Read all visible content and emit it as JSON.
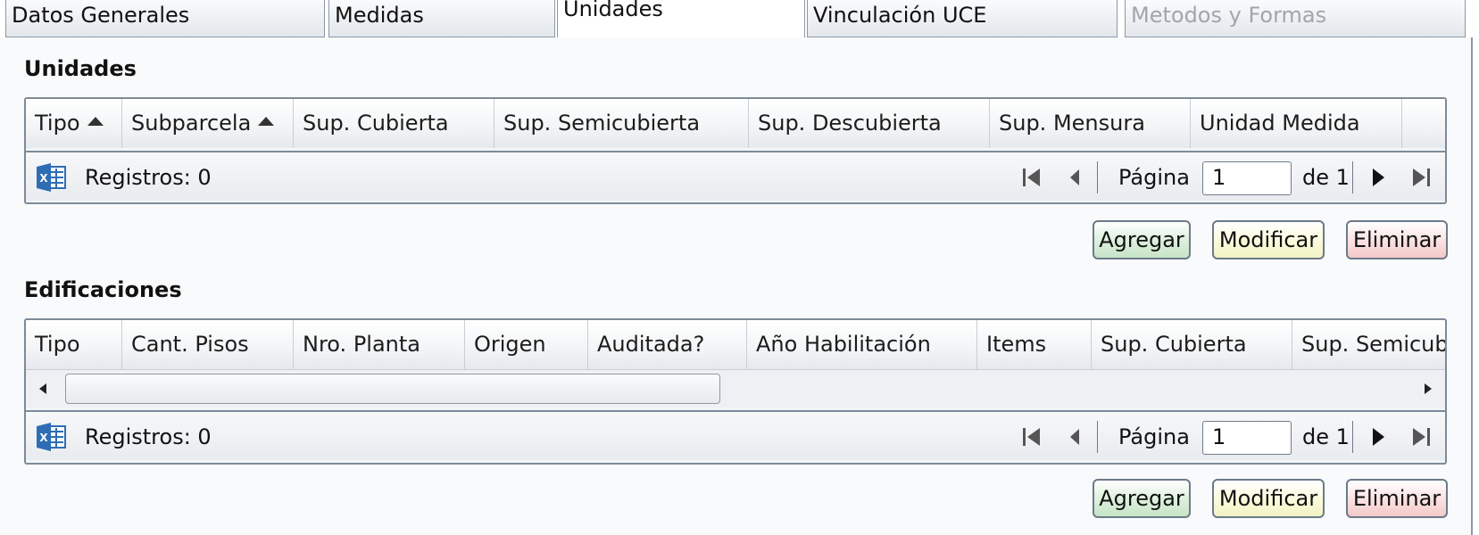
{
  "tabs": [
    {
      "label": "Datos Generales",
      "state": "normal"
    },
    {
      "label": "Medidas",
      "state": "normal"
    },
    {
      "label": "Unidades",
      "state": "active"
    },
    {
      "label": "Vinculación UCE",
      "state": "normal"
    },
    {
      "label": "Metodos y Formas",
      "state": "disabled"
    }
  ],
  "unidades": {
    "title": "Unidades",
    "columns": [
      "Tipo",
      "Subparcela",
      "Sup. Cubierta",
      "Sup. Semicubierta",
      "Sup. Descubierta",
      "Sup. Mensura",
      "Unidad Medida"
    ],
    "records_label": "Registros: 0",
    "page_label": "Página",
    "page_value": "1",
    "of_label": "de 1",
    "buttons": {
      "add": "Agregar",
      "edit": "Modificar",
      "delete": "Eliminar"
    }
  },
  "edificaciones": {
    "title": "Edificaciones",
    "columns": [
      "Tipo",
      "Cant. Pisos",
      "Nro. Planta",
      "Origen",
      "Auditada?",
      "Año Habilitación",
      "Items",
      "Sup. Cubierta",
      "Sup. Semicubi"
    ],
    "records_label": "Registros: 0",
    "page_label": "Página",
    "page_value": "1",
    "of_label": "de 1",
    "buttons": {
      "add": "Agregar",
      "edit": "Modificar",
      "delete": "Eliminar"
    }
  },
  "colors": {
    "accent_border": "#7c8b99",
    "excel": "#2e6db4",
    "add": "#c7e4c7",
    "edit": "#f2f2c4",
    "delete": "#f4c9c9"
  },
  "icons": [
    "excel-export-icon",
    "first-page-icon",
    "prev-page-icon",
    "next-page-icon",
    "last-page-icon",
    "sort-ascending-icon",
    "scroll-left-icon",
    "scroll-right-icon"
  ]
}
